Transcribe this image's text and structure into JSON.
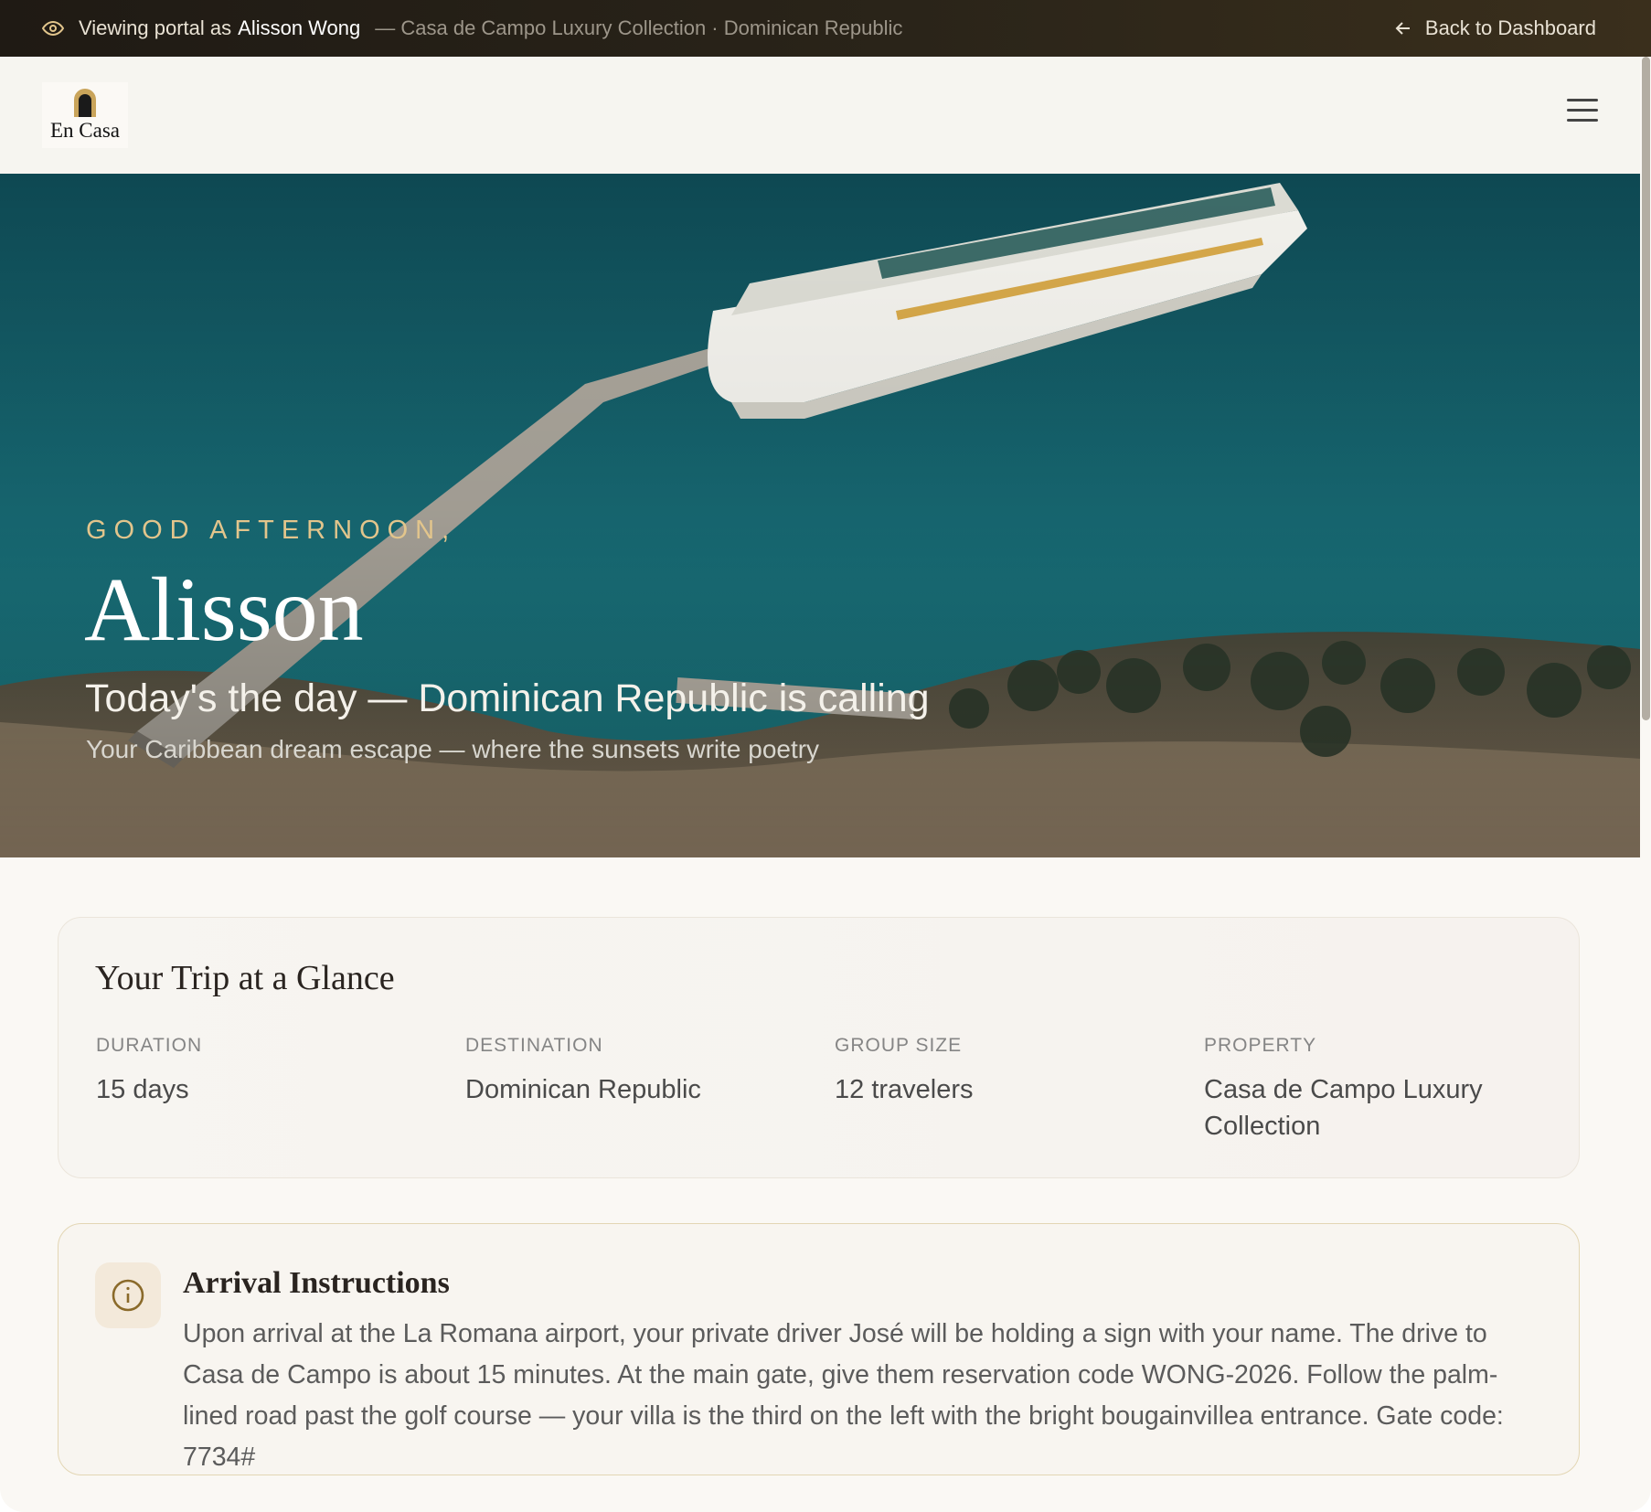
{
  "banner": {
    "viewing_prefix": "Viewing portal as",
    "user_name": "Alisson Wong",
    "context": "— Casa de Campo Luxury Collection · Dominican Republic",
    "back_label": "Back to Dashboard"
  },
  "header": {
    "logo_text": "En Casa",
    "menu_icon": "hamburger-menu-icon"
  },
  "hero": {
    "greeting": "GOOD AFTERNOON,",
    "name": "Alisson",
    "tagline": "Today's the day — Dominican Republic is calling",
    "subtitle": "Your Caribbean dream escape — where the sunsets write poetry"
  },
  "trip": {
    "title": "Your Trip at a Glance",
    "stats": [
      {
        "label": "DURATION",
        "value": "15 days"
      },
      {
        "label": "DESTINATION",
        "value": "Dominican Republic"
      },
      {
        "label": "GROUP SIZE",
        "value": "12 travelers"
      },
      {
        "label": "PROPERTY",
        "value": "Casa de Campo Luxury Collection"
      }
    ]
  },
  "arrival": {
    "title": "Arrival Instructions",
    "text": "Upon arrival at the La Romana airport, your private driver José will be holding a sign with your name. The drive to Casa de Campo is about 15 minutes. At the main gate, give them reservation code WONG-2026. Follow the palm-lined road past the golf course — your villa is the third on the left with the bright bougainvillea entrance. Gate code: 7734#"
  },
  "colors": {
    "accent_gold": "#e2c58c",
    "banner_bg": "#1f1a14",
    "card_border_gold": "#e3d6b4"
  }
}
